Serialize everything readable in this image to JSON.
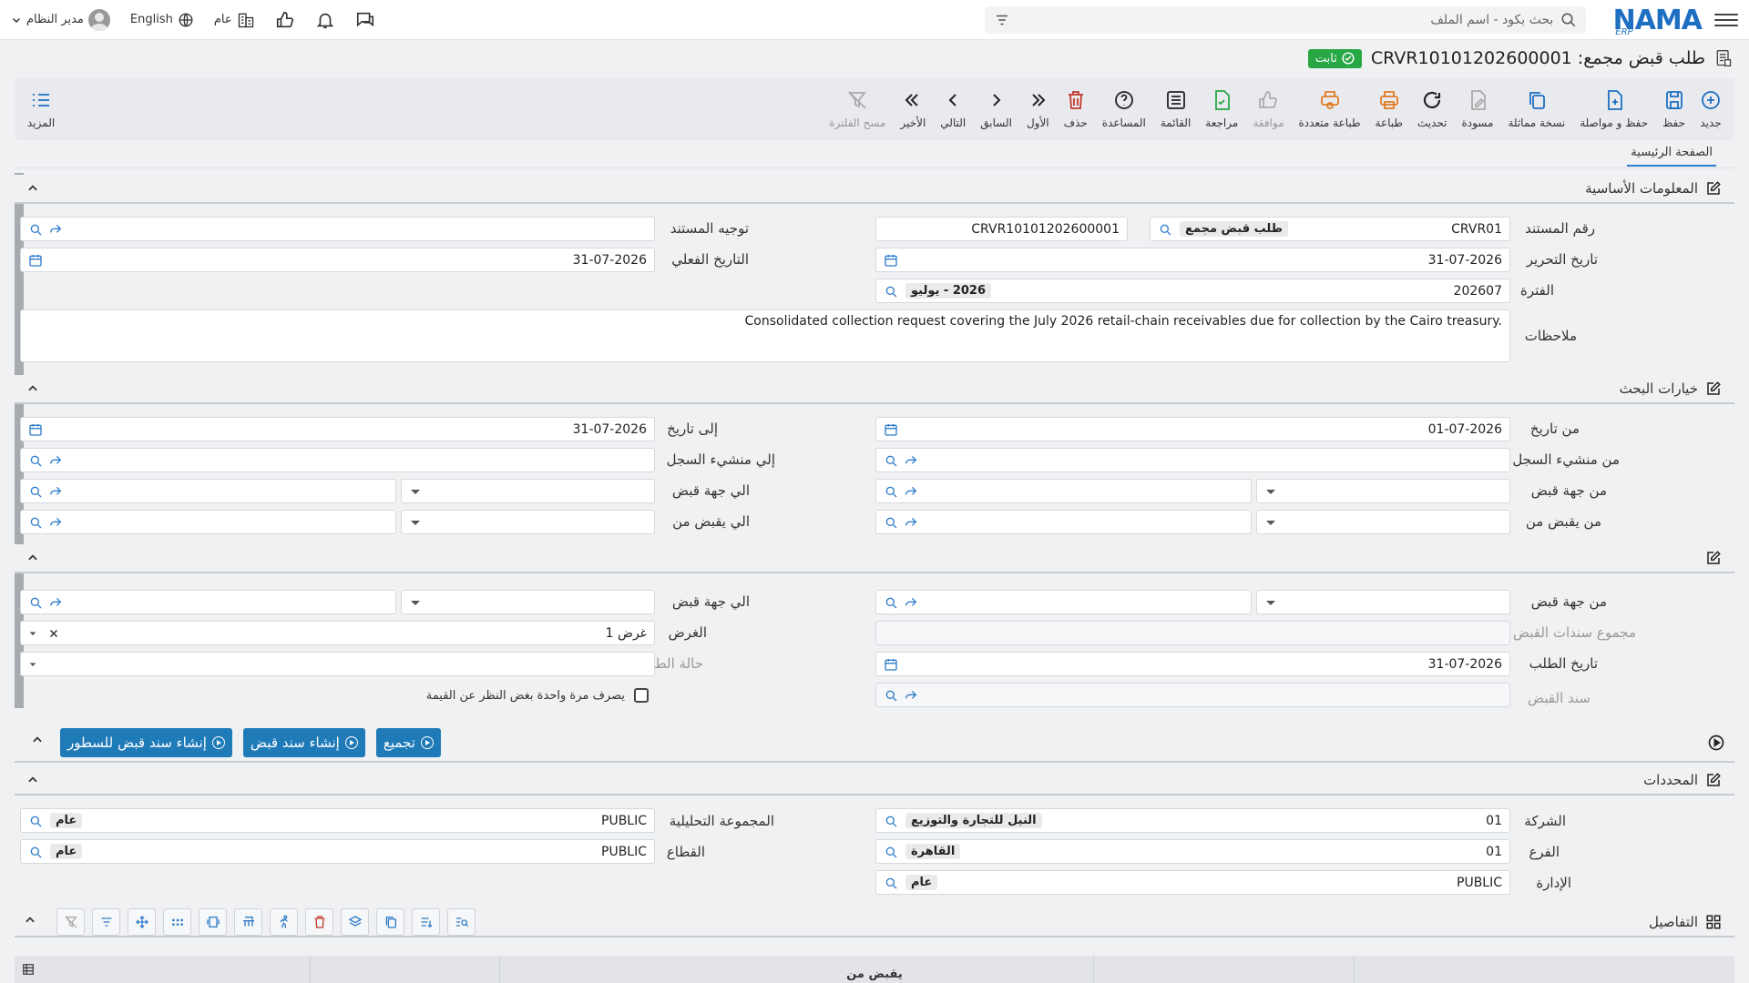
{
  "app": {
    "logo": "NAMA",
    "logo_sub": "ERP",
    "search_placeholder": "بحث بكود - اسم الملف",
    "user": "مدير النظام",
    "language": "English",
    "scope": "عام"
  },
  "page": {
    "title": "طلب قبض مجمع: CRVR10101202600001",
    "status": "ثابت"
  },
  "toolbar": {
    "new": "جديد",
    "save": "حفظ",
    "save_continue": "حفظ و مواصلة",
    "copy": "نسخة مماثلة",
    "draft": "مسودة",
    "refresh": "تحديث",
    "print": "طباعة",
    "multi_print": "طباعة متعددة",
    "approve": "موافقة",
    "review": "مراجعة",
    "list": "القائمة",
    "help": "المساعدة",
    "delete": "حذف",
    "first": "الأول",
    "prev": "السابق",
    "next": "التالي",
    "last": "الأخير",
    "clear_filter": "مسح الفلترة",
    "more": "المزيد"
  },
  "tab": {
    "main": "الصفحة الرئيسية"
  },
  "basic": {
    "title": "المعلومات الأساسية",
    "doc_no_label": "رقم المستند",
    "doc_prefix": "CRVR01",
    "doc_type": "طلب قبض مجمع",
    "doc_code": "CRVR10101202600001",
    "direction_label": "توجيه المستند",
    "edit_date_label": "تاريخ التحرير",
    "edit_date": "31-07-2026",
    "actual_date_label": "التاريخ الفعلي",
    "actual_date": "31-07-2026",
    "period_label": "الفترة",
    "period_code": "202607",
    "period_name": "2026 - يوليو",
    "notes_label": "ملاحظات",
    "notes": "Consolidated collection request covering the July 2026 retail-chain receivables due for collection by the Cairo treasury."
  },
  "search": {
    "title": "خيارات البحث",
    "from_date_label": "من تاريخ",
    "from_date": "01-07-2026",
    "to_date_label": "إلى تاريخ",
    "to_date": "31-07-2026",
    "from_creator_label": "من منشيء السجل",
    "to_creator_label": "إلي منشيء السجل",
    "from_party_label": "من جهة قبض",
    "to_party_label": "الي جهة قبض",
    "from_payer_label": "من يقبض من",
    "to_payer_label": "الي يقبض من"
  },
  "sec3": {
    "from_party_label": "من جهة قبض",
    "to_party_label": "الي جهة قبض",
    "total_label": "مجموع سندات القبض",
    "purpose_label": "الغرض",
    "purpose": "غرض 1",
    "req_date_label": "تاريخ الطلب",
    "req_date": "31-07-2026",
    "status_label": "حالة الطلب",
    "voucher_label": "سند القبض",
    "once_label": "يصرف مرة واحدة بغض النظر عن القيمة"
  },
  "actions": {
    "group": "تجميع",
    "create_voucher": "إنشاء سند قبض",
    "create_lines": "إنشاء سند قبض للسطور"
  },
  "dims": {
    "title": "المحددات",
    "company_label": "الشركة",
    "company_code": "01",
    "company_name": "النيل للتجارة والتوزيع",
    "branch_label": "الفرع",
    "branch_code": "01",
    "branch_name": "القاهرة",
    "dept_label": "الإدارة",
    "dept_code": "PUBLIC",
    "dept_name": "عام",
    "analytic_label": "المجموعة التحليلية",
    "analytic_code": "PUBLIC",
    "analytic_name": "عام",
    "sector_label": "القطاع",
    "sector_code": "PUBLIC",
    "sector_name": "عام"
  },
  "details": {
    "title": "التفاصيل",
    "col_payer": "يقبض من"
  },
  "colors": {
    "accent": "#1f7ab8",
    "brand": "#1e6fc2",
    "ok": "#28a745",
    "danger": "#c0392b",
    "warn": "#e07b24"
  }
}
